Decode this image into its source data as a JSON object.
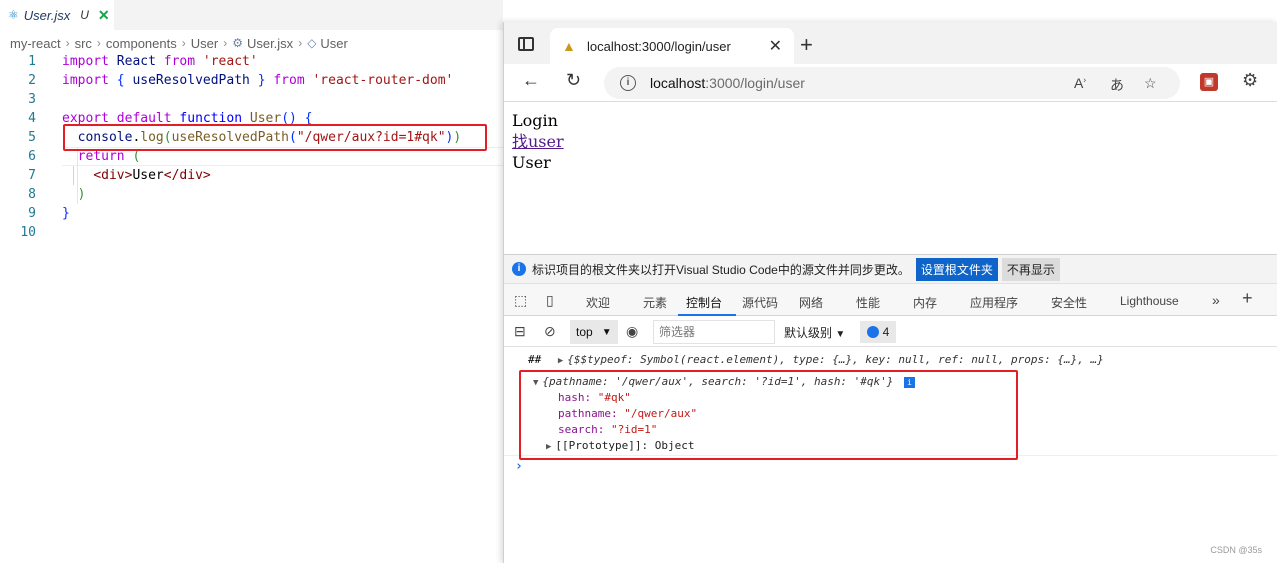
{
  "editor": {
    "tab": {
      "icon": "react-icon",
      "filename": "User.jsx",
      "status": "U",
      "close": "✕"
    },
    "breadcrumb": [
      "my-react",
      "src",
      "components",
      "User",
      "User.jsx",
      "User"
    ],
    "lines": [
      "1",
      "2",
      "3",
      "4",
      "5",
      "6",
      "7",
      "8",
      "9",
      "10"
    ]
  },
  "browser": {
    "tab_title": "localhost:3000/login/user",
    "address_host": "localhost",
    "address_path": ":3000/login/user",
    "page": {
      "line1": "Login",
      "link": "找user",
      "line3": "User"
    }
  },
  "devtools": {
    "infobar": {
      "text": "标识项目的根文件夹以打开Visual Studio Code中的源文件并同步更改。",
      "primary_button": "设置根文件夹",
      "secondary_button": "不再显示"
    },
    "tabs": [
      "欢迎",
      "元素",
      "控制台",
      "源代码",
      "网络",
      "性能",
      "内存",
      "应用程序",
      "安全性",
      "Lighthouse"
    ],
    "active_tab": "控制台",
    "toolbar": {
      "context": "top",
      "filter_placeholder": "筛选器",
      "levels": "默认级别",
      "issues_count": "4"
    },
    "console": {
      "row1_prefix": "##",
      "row1": "{$$typeof: Symbol(react.element), type: {…}, key: null, ref: null, props: {…}, …}",
      "row2": "{pathname: '/qwer/aux', search: '?id=1', hash: '#qk'}",
      "hash_key": "hash:",
      "hash_val": "\"#qk\"",
      "pathname_key": "pathname:",
      "pathname_val": "\"/qwer/aux\"",
      "search_key": "search:",
      "search_val": "\"?id=1\"",
      "proto": "[[Prototype]]: Object"
    }
  },
  "watermark": "CSDN @35s",
  "colors": {
    "highlight": "#e41e25",
    "accent": "#1a73e8"
  }
}
